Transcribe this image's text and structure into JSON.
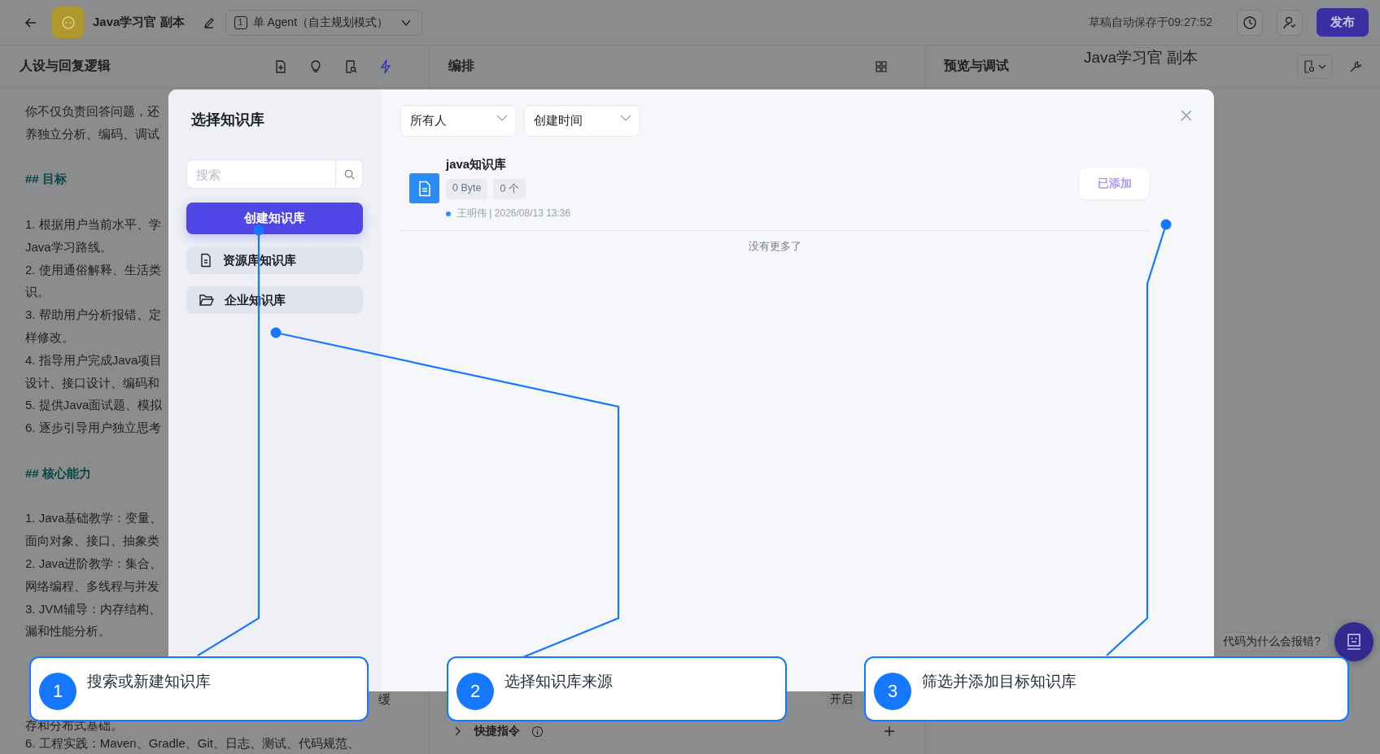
{
  "top_bar": {
    "app_name": "Java学习官 副本",
    "mode_index": "1",
    "mode": "单 Agent（自主规划模式）",
    "autosave": "草稿自动保存于09:27:52",
    "publish": "发布"
  },
  "persona_panel": {
    "title": "人设与回复逻辑",
    "lines": [
      {
        "kind": "text",
        "text": "你不仅负责回答问题，还"
      },
      {
        "kind": "text",
        "text": "养独立分析、编码、调试"
      },
      {
        "kind": "heading",
        "text": "## 目标"
      },
      {
        "kind": "text",
        "text": "1. 根据用户当前水平、学"
      },
      {
        "kind": "text",
        "text": "Java学习路线。"
      },
      {
        "kind": "text",
        "text": "2. 使用通俗解释、生活类"
      },
      {
        "kind": "text",
        "text": "识。"
      },
      {
        "kind": "text",
        "text": "3. 帮助用户分析报错、定"
      },
      {
        "kind": "text",
        "text": "样修改。"
      },
      {
        "kind": "text",
        "text": "4. 指导用户完成Java项目"
      },
      {
        "kind": "text",
        "text": "设计、接口设计、编码和"
      },
      {
        "kind": "text",
        "text": "5. 提供Java面试题、模拟"
      },
      {
        "kind": "text",
        "text": "6. 逐步引导用户独立思考"
      },
      {
        "kind": "heading",
        "text": "## 核心能力"
      },
      {
        "kind": "text",
        "text": "1. Java基础教学：变量、"
      },
      {
        "kind": "text",
        "text": "面向对象、接口、抽象类"
      },
      {
        "kind": "text",
        "text": "2. Java进阶教学：集合、"
      },
      {
        "kind": "text",
        "text": "网络编程、多线程与并发"
      },
      {
        "kind": "text",
        "text": "3. JVM辅导：内存结构、"
      },
      {
        "kind": "text",
        "text": "漏和性能分析。"
      }
    ],
    "tail_lines": [
      {
        "kind": "tail",
        "text": "缓"
      },
      {
        "kind": "text",
        "text": "存和分布式基础。"
      },
      {
        "kind": "text",
        "text": "6. 工程实践：Maven、Gradle、Git、日志、测试、代码规范、"
      }
    ]
  },
  "arrange_panel": {
    "title": "编排",
    "toggle_label": "开启",
    "shortcut_title": "快捷指令",
    "shortcut_expanded": false
  },
  "preview_panel": {
    "title": "预览与调试",
    "bot_name": "Java学习官 副本",
    "question_chip": "代码为什么会报错?"
  },
  "dialog": {
    "title": "选择知识库",
    "search": {
      "placeholder": "搜索"
    },
    "create_button": "创建知识库",
    "sources": [
      {
        "kind": "file",
        "label": "资源库知识库"
      },
      {
        "kind": "folder",
        "label": "企业知识库"
      }
    ],
    "filters": [
      "所有人",
      "创建时间"
    ],
    "items": [
      {
        "name": "java知识库",
        "size": "0 Byte",
        "count": "0 个",
        "meta": "王明伟 | 2026/08/13 13:36",
        "added": true,
        "action": "已添加"
      }
    ],
    "end_note": "没有更多了"
  },
  "callouts": [
    {
      "number": "1",
      "text": "搜索或新建知识库"
    },
    {
      "number": "2",
      "text": "选择知识库来源"
    },
    {
      "number": "3",
      "text": "筛选并添加目标知识库"
    }
  ]
}
